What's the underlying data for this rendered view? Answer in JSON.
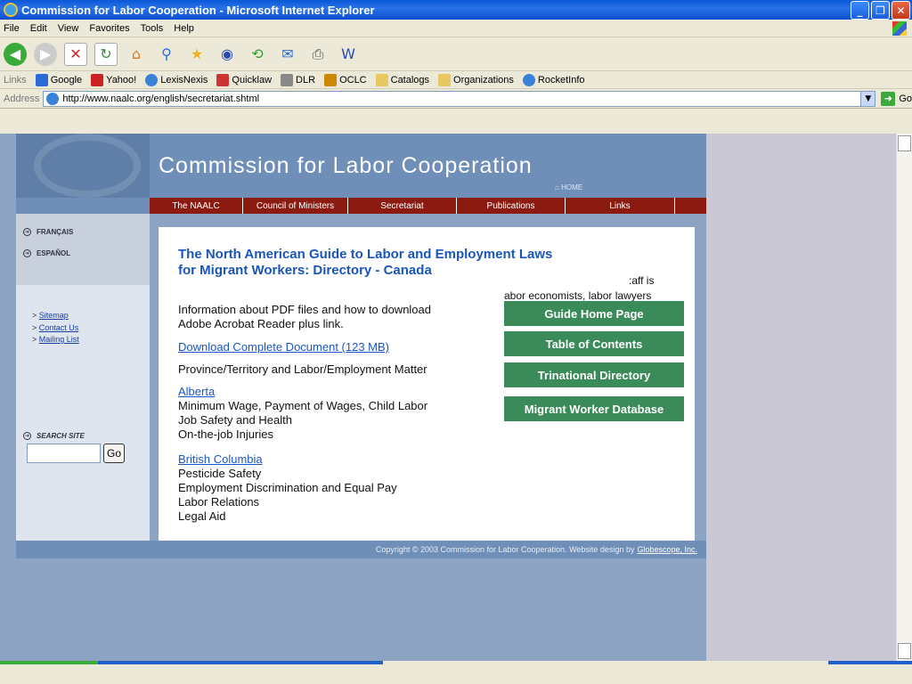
{
  "window": {
    "title": "Commission for Labor Cooperation - Microsoft Internet Explorer",
    "minimize": "_",
    "maximize": "❐",
    "close": "✕"
  },
  "menu": [
    "File",
    "Edit",
    "View",
    "Favorites",
    "Tools",
    "Help"
  ],
  "links_bar": {
    "label": "Links",
    "items": [
      "Google",
      "Yahoo!",
      "LexisNexis",
      "Quicklaw",
      "DLR",
      "OCLC",
      "Catalogs",
      "Organizations",
      "RocketInfo"
    ]
  },
  "address": {
    "label": "Address",
    "url": "http://www.naalc.org/english/secretariat.shtml",
    "go": "Go"
  },
  "site": {
    "title": "Commission for Labor Cooperation",
    "home": "HOME",
    "nav": [
      "The NAALC",
      "Council of Ministers",
      "Secretariat",
      "Publications",
      "Links"
    ]
  },
  "sidebar": {
    "languages": [
      "FRANÇAIS",
      "ESPAÑOL"
    ],
    "links": [
      "Sitemap",
      "Contact Us",
      "Mailing List"
    ],
    "search_label": "SEARCH SITE",
    "search_go": "Go"
  },
  "content": {
    "title_line1": "The North American Guide to Labor and Employment Laws",
    "title_line2": "for Migrant Workers:  Directory - Canada",
    "pdf_info_line1": "Information about PDF files and how to download",
    "pdf_info_line2": "Adobe Acrobat Reader plus link.",
    "download_link": "Download Complete Document (123 MB)",
    "province_heading": "Province/Territory and Labor/Employment Matter",
    "alberta_link": "Alberta",
    "alberta_items": [
      "Minimum Wage, Payment of Wages, Child Labor",
      "Job Safety and Health",
      "On-the-job Injuries"
    ],
    "bc_link": "British Columbia",
    "bc_items": [
      "Pesticide Safety",
      "Employment Discrimination and Equal Pay",
      "Labor Relations",
      "Legal Aid"
    ],
    "fragment1": ":aff is",
    "fragment2": "abor economists, labor lawyers",
    "buttons": [
      "Guide Home Page",
      "Table of Contents",
      "Trinational Directory",
      "Migrant Worker Database"
    ]
  },
  "footer": {
    "text": "Copyright © 2003 Commission for Labor Cooperation. Website design by",
    "link": "Globescope, Inc."
  }
}
